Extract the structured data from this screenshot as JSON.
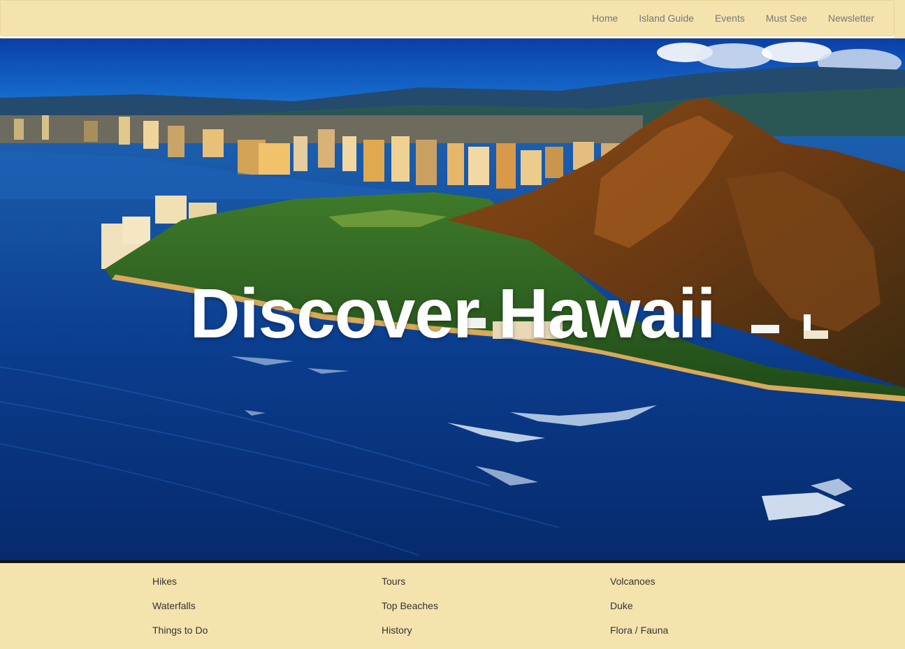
{
  "navbar": {
    "links": [
      "Home",
      "Island Guide",
      "Events",
      "Must See",
      "Newsletter"
    ]
  },
  "hero": {
    "title": "Discover Hawaii"
  },
  "footer": {
    "columns": [
      [
        "Hikes",
        "Waterfalls",
        "Things to Do"
      ],
      [
        "Tours",
        "Top Beaches",
        "History"
      ],
      [
        "Volcanoes",
        "Duke",
        "Flora / Fauna"
      ]
    ]
  },
  "colors": {
    "nav_background": "#f5e3ae",
    "nav_link": "#777777",
    "footer_link": "#333333",
    "hero_title": "#ffffff"
  }
}
